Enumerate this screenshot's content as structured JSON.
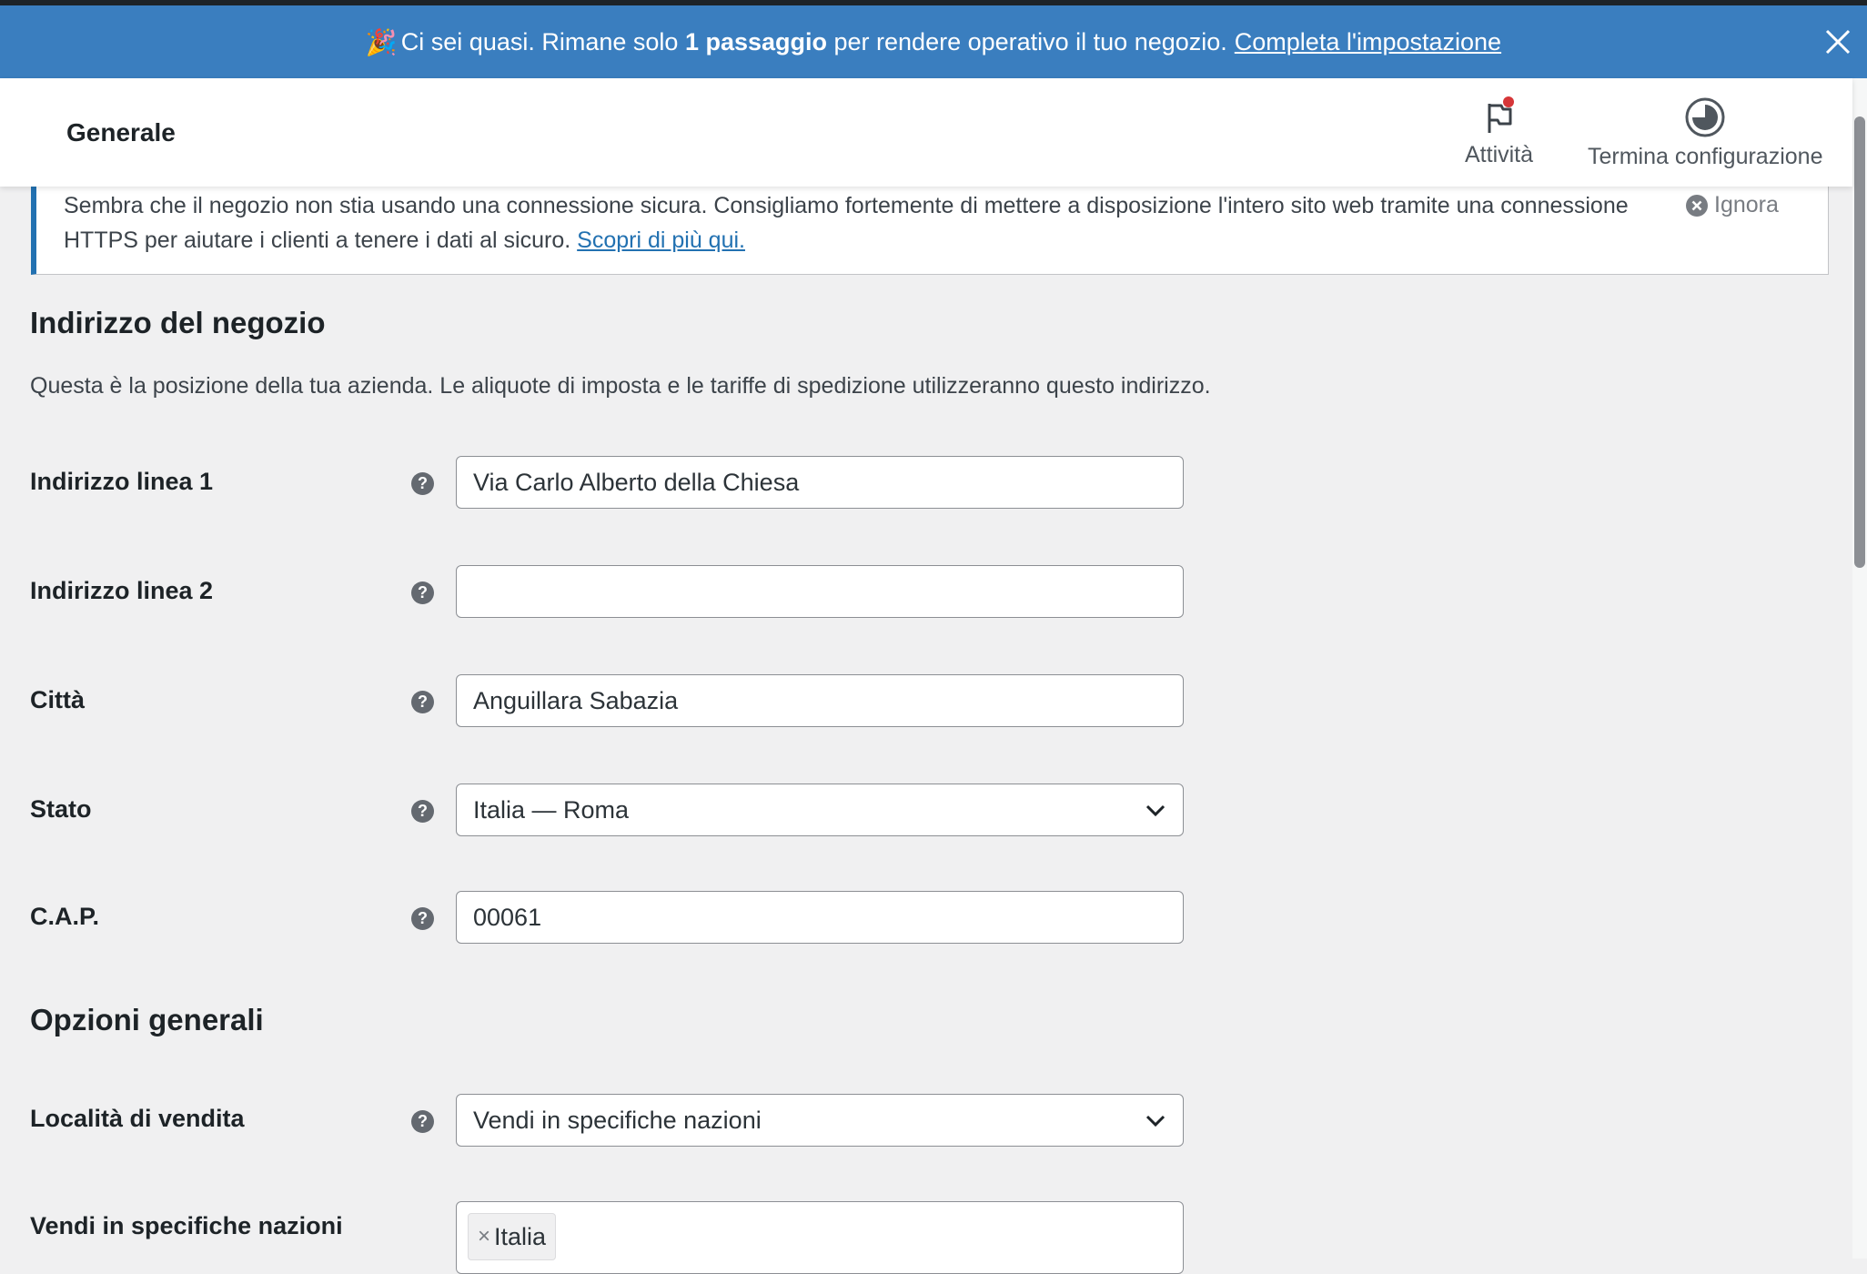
{
  "banner": {
    "text_before": "Ci sei quasi. Rimane solo ",
    "bold": "1 passaggio",
    "text_after": " per rendere operativo il tuo negozio.",
    "link": "Completa l'impostazione",
    "icon": "party-popper-icon"
  },
  "header": {
    "title": "Generale",
    "activity_label": "Attività",
    "finish_label": "Termina configurazione"
  },
  "notice": {
    "message": "Sembra che il negozio non stia usando una connessione sicura. Consigliamo fortemente di mettere a disposizione l'intero sito web tramite una connessione HTTPS per aiutare i clienti a tenere i dati al sicuro.",
    "link": "Scopri di più qui.",
    "dismiss": "Ignora"
  },
  "store_address": {
    "title": "Indirizzo del negozio",
    "description": "Questa è la posizione della tua azienda. Le aliquote di imposta e le tariffe di spedizione utilizzeranno questo indirizzo.",
    "address1": {
      "label": "Indirizzo linea 1",
      "value": "Via Carlo Alberto della Chiesa"
    },
    "address2": {
      "label": "Indirizzo linea 2",
      "value": ""
    },
    "city": {
      "label": "Città",
      "value": "Anguillara Sabazia"
    },
    "state": {
      "label": "Stato",
      "value": "Italia — Roma"
    },
    "postcode": {
      "label": "C.A.P.",
      "value": "00061"
    }
  },
  "general_options": {
    "title": "Opzioni generali",
    "selling_location": {
      "label": "Località di vendita",
      "value": "Vendi in specifiche nazioni"
    },
    "specific_countries": {
      "label": "Vendi in specifiche nazioni",
      "tags": [
        "Italia"
      ]
    }
  },
  "help_glyph": "?",
  "tag_remove_glyph": "×",
  "colors": {
    "banner": "#3a7ebf",
    "accent": "#2271b1",
    "notification_dot": "#d63638"
  }
}
